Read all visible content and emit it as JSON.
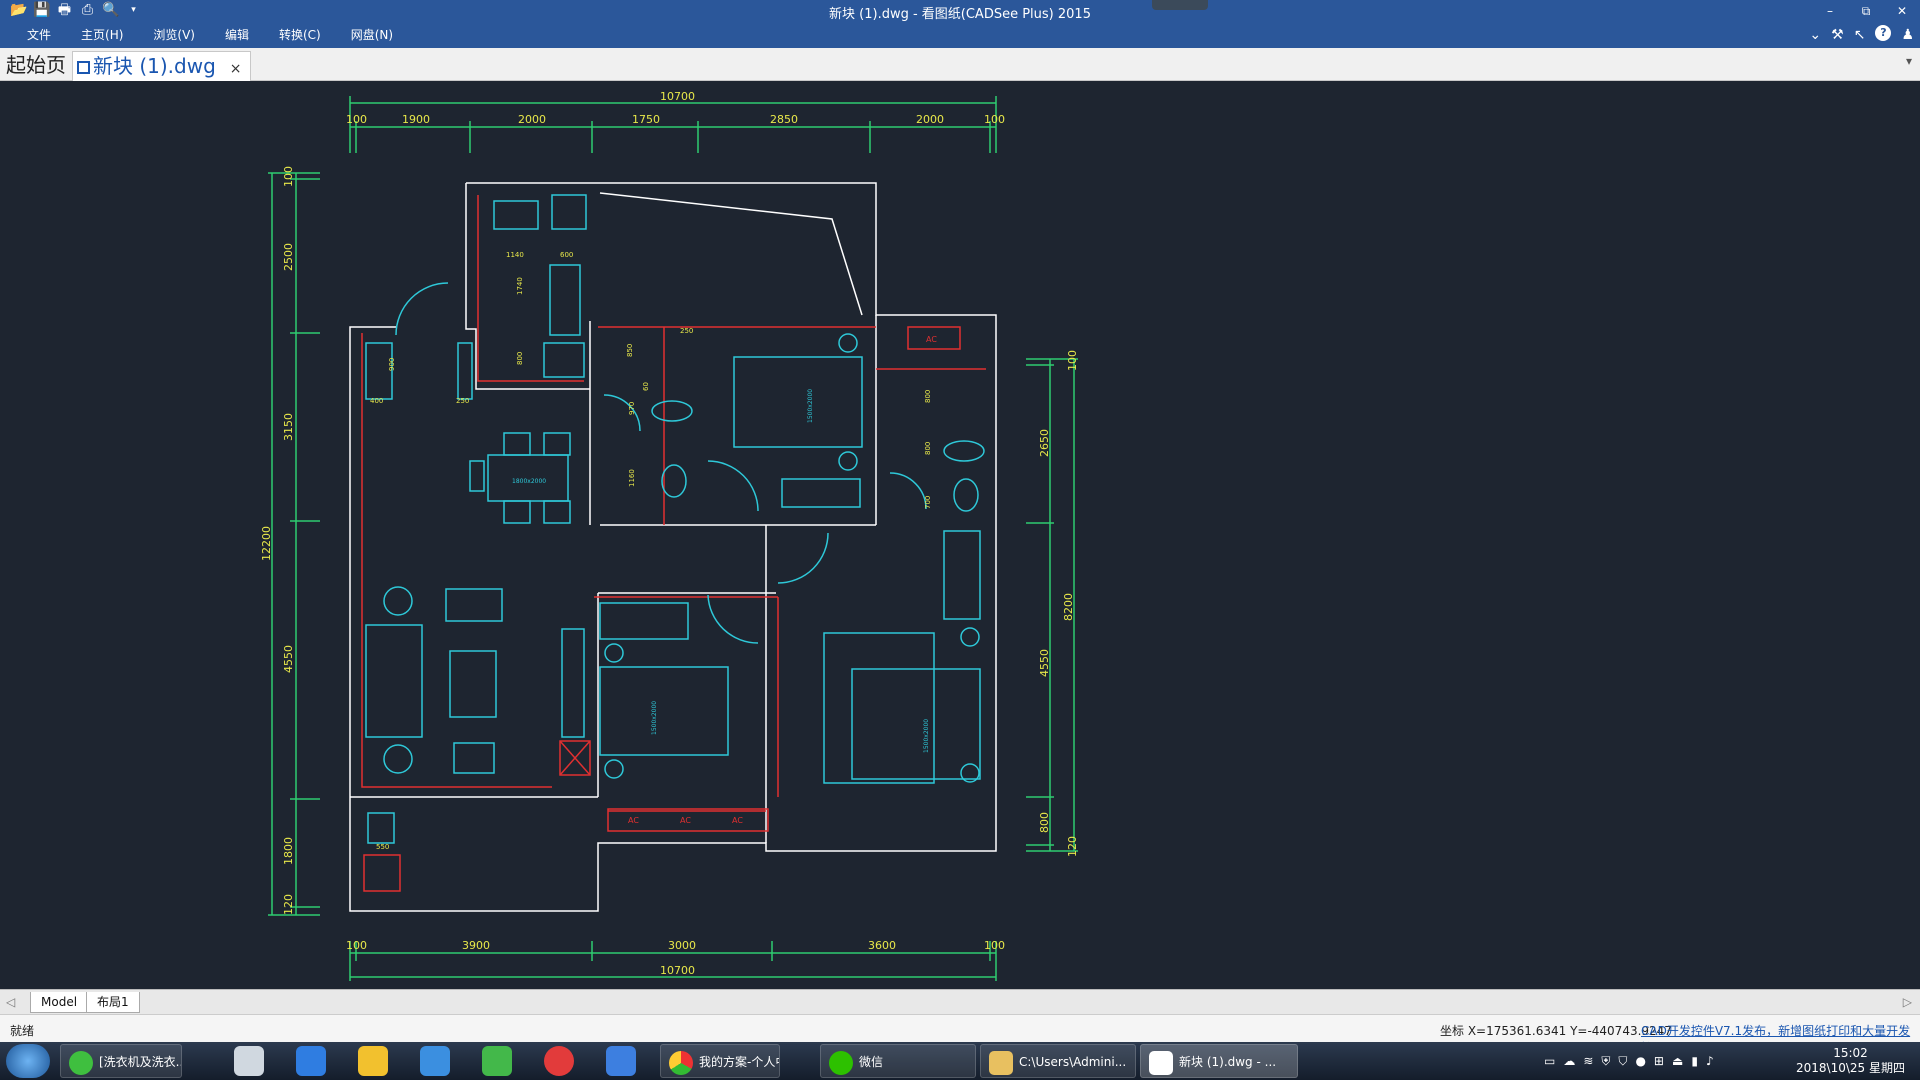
{
  "window": {
    "title": "新块 (1).dwg - 看图纸(CADSee Plus) 2015",
    "quick_access_icons": [
      "open-icon",
      "save-icon",
      "print-icon",
      "print-preview-icon",
      "zoom-icon",
      "customize-icon"
    ],
    "controls": {
      "minimize": "–",
      "restore": "⧉",
      "close": "✕"
    }
  },
  "menu": {
    "items": [
      "文件",
      "主页(H)",
      "浏览(V)",
      "编辑",
      "转换(C)",
      "网盘(N)"
    ],
    "right_icons": {
      "expand": "⌄",
      "tools": "⚒",
      "cursor": "↖",
      "help": "?",
      "user": "♟"
    }
  },
  "tabs": [
    {
      "label": "起始页"
    },
    {
      "label": "新块 (1).dwg",
      "close": "×"
    }
  ],
  "drawing": {
    "dims_top": [
      "10700",
      "100",
      "1900",
      "2000",
      "1750",
      "2850",
      "2000",
      "100"
    ],
    "dims_bottom": [
      "100",
      "3900",
      "3000",
      "3600",
      "100",
      "10700"
    ],
    "dims_left": [
      "100",
      "2500",
      "3150",
      "12200",
      "4550",
      "1800",
      "120"
    ],
    "dims_right": [
      "100",
      "2650",
      "8200",
      "4550",
      "800",
      "120"
    ],
    "small_labels": [
      "1140",
      "600",
      "1740",
      "800",
      "900",
      "400",
      "250",
      "850",
      "60",
      "970",
      "1160",
      "250",
      "800",
      "700",
      "800",
      "550"
    ],
    "furniture_labels": [
      "1800x2000",
      "1500x2000",
      "1500x2000",
      "1500x2000"
    ],
    "ac_labels": [
      "AC",
      "AC",
      "AC",
      "AC"
    ]
  },
  "layouts": {
    "prev": "◁",
    "tabs": [
      "Model",
      "布局1"
    ],
    "next": "▷"
  },
  "status": {
    "ready": "就绪",
    "coords": "坐标 X=175361.6341 Y=-440743.9247",
    "link": "CAD开发控件V7.1发布，新增图纸打印和大量开发接口！"
  },
  "taskbar": {
    "buttons": [
      {
        "label": "[洗衣机及洗衣..."
      },
      {
        "label": "我的方案-个人中..."
      },
      {
        "label": "微信"
      },
      {
        "label": "C:\\Users\\Admini..."
      },
      {
        "label": "新块 (1).dwg - ..."
      }
    ],
    "pinned": [
      "calculator-icon",
      "baidu-netdisk-icon",
      "notepad-icon",
      "feishu-icon",
      "evernote-icon",
      "netease-music-icon",
      "shield-app-icon"
    ],
    "tray_icons": [
      "keyboard-icon",
      "cloud-icon",
      "wifi-icon",
      "shield-icon",
      "defender-icon",
      "wechat-tray-icon",
      "network-icon",
      "usb-icon",
      "signal-icon",
      "volume-icon"
    ],
    "clock_time": "15:02",
    "clock_date": "2018\\10\\25 星期四"
  },
  "colors": {
    "canvas": "#1e2530",
    "titlebar": "#2b579a",
    "wall": "#ffffff",
    "cyan": "#2ec8d8",
    "dim": "#2ecc71",
    "red": "#e03030",
    "yellow": "#e8e84a"
  }
}
